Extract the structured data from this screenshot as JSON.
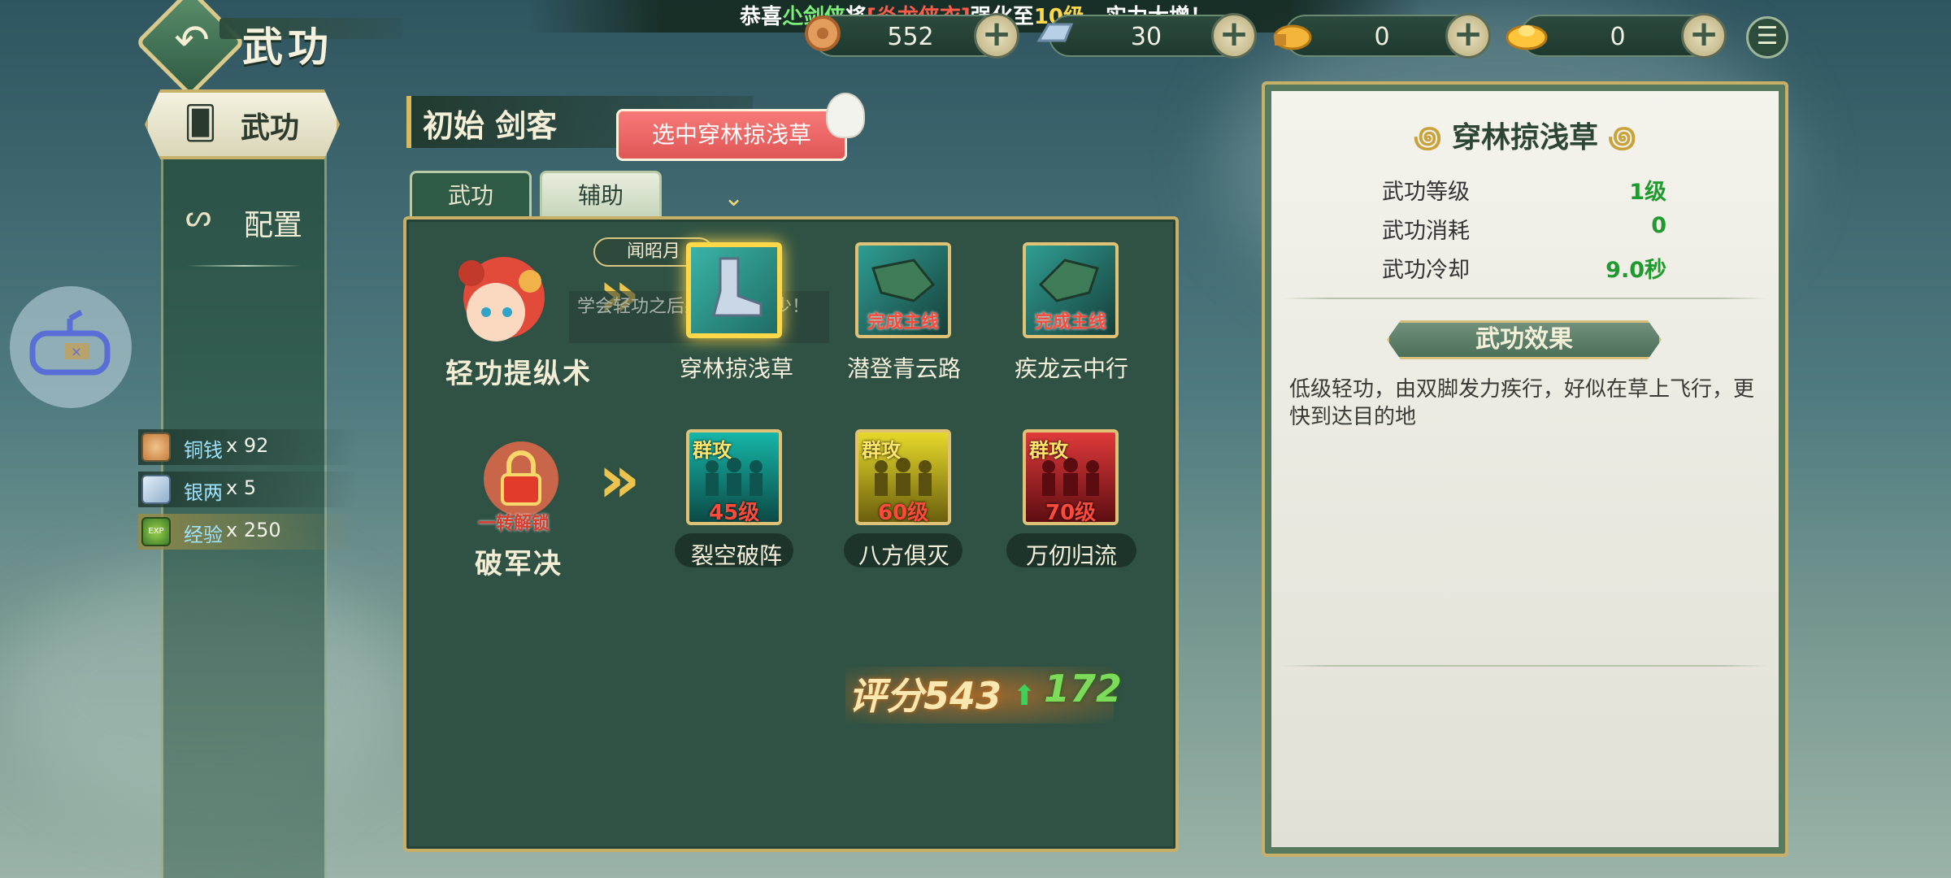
{
  "window": {
    "title": "武功"
  },
  "broadcast": {
    "prefix": "恭喜",
    "player": "尐剑侠",
    "mid": "将",
    "item": "[炎龙侠衣]",
    "mid2": "强化至",
    "level": "10级",
    "suffix": "，实力大增！"
  },
  "currencies": [
    {
      "name": "coin-icon",
      "value": "552"
    },
    {
      "name": "silver-icon",
      "value": "30"
    },
    {
      "name": "locked-gold-icon",
      "value": "0"
    },
    {
      "name": "gold-icon",
      "value": "0"
    }
  ],
  "sidebar": {
    "tabs": [
      {
        "label": "武功",
        "icon": "cards-icon",
        "active": true
      },
      {
        "label": "配置",
        "icon": "link-icon",
        "active": false
      }
    ]
  },
  "resources": [
    {
      "label": "铜钱",
      "count": "x 92"
    },
    {
      "label": "银两",
      "count": "x 5"
    },
    {
      "label": "经验",
      "count": "x 250"
    }
  ],
  "character": {
    "name": "初始 剑客"
  },
  "tip": {
    "text": "选中穿林掠浅草"
  },
  "subtabs": [
    "武功",
    "辅助"
  ],
  "rows": [
    {
      "title": "轻功提纵术",
      "npc_tag": "闻昭月",
      "overlay_text": "学会轻功之后果然提速不少！",
      "skills": [
        {
          "name": "穿林掠浅草",
          "tag": "",
          "selected": true
        },
        {
          "name": "潜登青云路",
          "tag": "完成主线"
        },
        {
          "name": "疾龙云中行",
          "tag": "完成主线"
        }
      ]
    },
    {
      "title": "破军决",
      "lock_tag": "一转解锁",
      "skills": [
        {
          "name": "裂空破阵",
          "tag": "群攻",
          "level": "45级"
        },
        {
          "name": "八方俱灭",
          "tag": "群攻",
          "level": "60级"
        },
        {
          "name": "万仞归流",
          "tag": "群攻",
          "level": "70级"
        }
      ]
    }
  ],
  "score": {
    "label": "评分",
    "value": "543",
    "gain": "172"
  },
  "detail": {
    "title": "穿林掠浅草",
    "stats": [
      {
        "label": "武功等级",
        "value": "1级"
      },
      {
        "label": "武功消耗",
        "value": "0"
      },
      {
        "label": "武功冷却",
        "value": "9.0秒"
      }
    ],
    "effect_title": "武功效果",
    "effect_desc": "低级轻功，由双脚发力疾行，好似在草上飞行，更快到达目的地"
  }
}
